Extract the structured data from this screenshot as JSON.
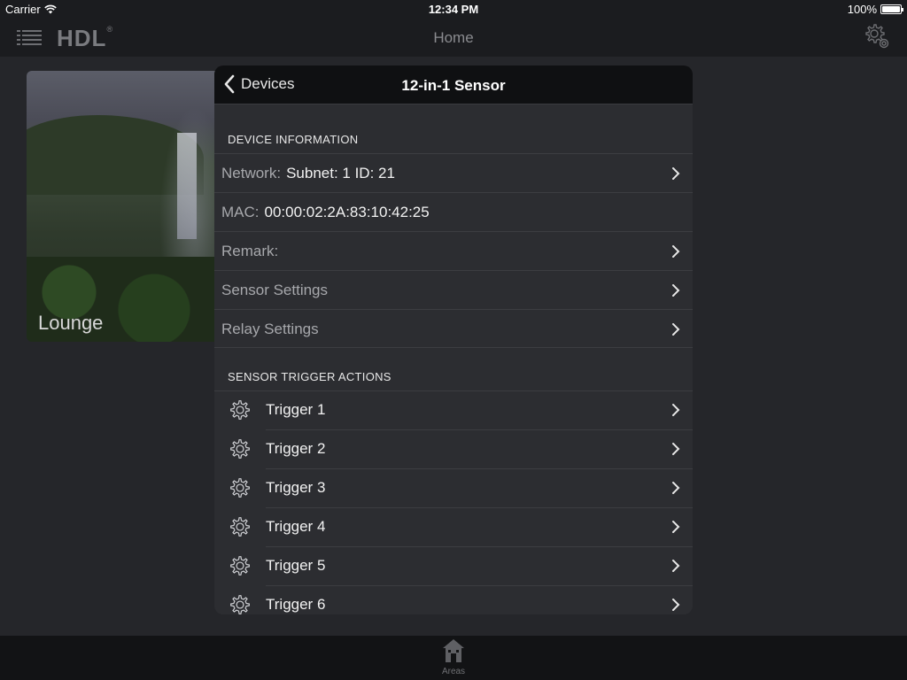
{
  "status_bar": {
    "carrier": "Carrier",
    "time": "12:34 PM",
    "battery": "100%"
  },
  "nav": {
    "logo": "HDL",
    "logo_mark": "®",
    "title": "Home"
  },
  "room_card": {
    "label": "Lounge"
  },
  "modal": {
    "back_label": "Devices",
    "title": "12-in-1 Sensor",
    "device_info": {
      "header": "DEVICE INFORMATION",
      "network_label": "Network:",
      "network_value": "Subnet: 1  ID: 21",
      "mac_label": "MAC:",
      "mac_value": "00:00:02:2A:83:10:42:25",
      "remark_label": "Remark:",
      "sensor_settings_label": "Sensor Settings",
      "relay_settings_label": "Relay Settings"
    },
    "trigger_actions": {
      "header": "SENSOR TRIGGER ACTIONS",
      "items": [
        "Trigger 1",
        "Trigger 2",
        "Trigger 3",
        "Trigger 4",
        "Trigger 5",
        "Trigger 6"
      ]
    }
  },
  "tab_bar": {
    "areas_label": "Areas"
  },
  "icons": {
    "menu": "menu-icon",
    "settings": "settings-gear-icon",
    "back": "chevron-left-icon",
    "row_chevron": "chevron-right-icon",
    "trigger": "gear-icon",
    "areas": "house-icon",
    "wifi": "wifi-icon",
    "battery": "battery-icon"
  }
}
